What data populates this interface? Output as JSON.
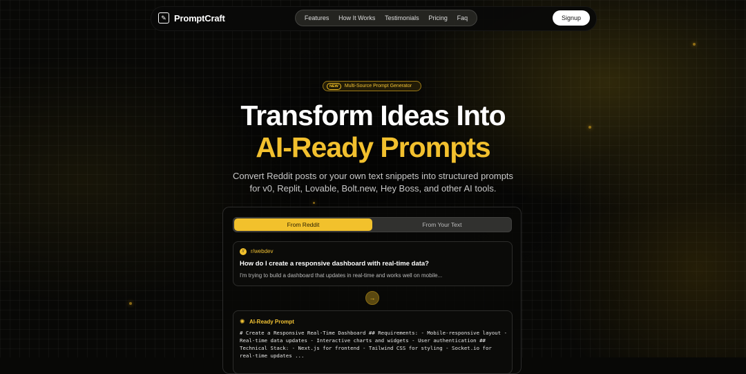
{
  "brand": {
    "name": "PromptCraft"
  },
  "nav": {
    "links": [
      "Features",
      "How It Works",
      "Testimonials",
      "Pricing",
      "Faq"
    ],
    "signup_label": "Signup"
  },
  "hero": {
    "badge_tag": "NEW",
    "badge_text": "Multi-Source Prompt Generator",
    "title_line1": "Transform Ideas Into",
    "title_line2": "AI-Ready Prompts",
    "subtitle_line1": "Convert Reddit posts or your own text snippets into structured prompts",
    "subtitle_line2": "for v0, Replit, Lovable, Bolt.new, Hey Boss, and other AI tools."
  },
  "demo": {
    "tabs": [
      {
        "label": "From Reddit",
        "active": true
      },
      {
        "label": "From Your Text",
        "active": false
      }
    ],
    "post": {
      "subreddit": "r/webdev",
      "title": "How do I create a responsive dashboard with real-time data?",
      "excerpt": "I'm trying to build a dashboard that updates in real-time and works well on mobile..."
    },
    "result": {
      "title": "AI-Ready Prompt",
      "body": "# Create a Responsive Real-Time Dashboard ## Requirements: - Mobile-responsive layout - Real-time data updates - Interactive charts and widgets - User authentication ## Technical Stack: - Next.js for frontend - Tailwind CSS for styling - Socket.io for real-time updates ..."
    }
  },
  "colors": {
    "accent": "#f2c12c",
    "background": "#080806"
  }
}
